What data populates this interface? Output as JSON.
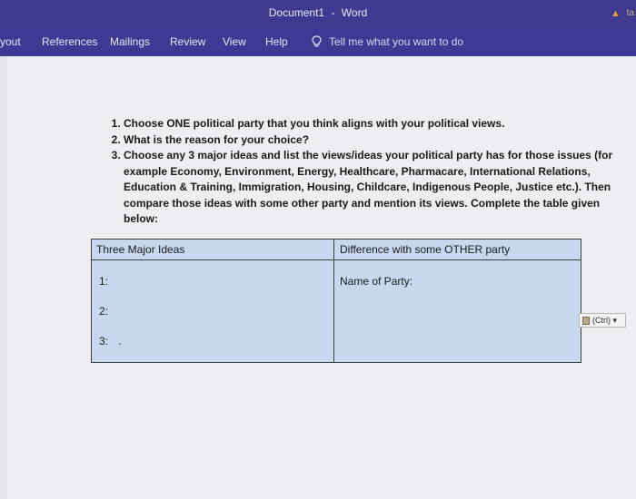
{
  "window": {
    "document_name": "Document1",
    "separator": "-",
    "app_name": "Word",
    "user_label": "ta"
  },
  "ribbon": {
    "tabs": [
      {
        "label": "yout"
      },
      {
        "label": "References"
      },
      {
        "label": "Mailings"
      },
      {
        "label": "Review"
      },
      {
        "label": "View"
      },
      {
        "label": "Help"
      }
    ],
    "tell_me": "Tell me what you want to do"
  },
  "document": {
    "questions": [
      "Choose ONE political party that you think aligns with your political views.",
      "What is the reason for your choice?",
      "Choose any 3 major ideas and list the views/ideas your political party has for those issues (for example Economy, Environment, Energy, Healthcare, Pharmacare, International Relations, Education & Training, Immigration, Housing, Childcare, Indigenous People, Justice etc.). Then compare those ideas with some other party and mention its views. Complete the table given below:"
    ],
    "table": {
      "headers": [
        "Three Major Ideas",
        "Difference with some OTHER party"
      ],
      "left_items": [
        "1:",
        "2:",
        "3:"
      ],
      "right_label": "Name of Party:"
    },
    "paste_button": "(Ctrl)"
  },
  "colors": {
    "titlebar": "#3f3a8f",
    "ribbon": "#3c3a92",
    "table_fill": "#c7d8ee",
    "page": "#edeef2"
  }
}
